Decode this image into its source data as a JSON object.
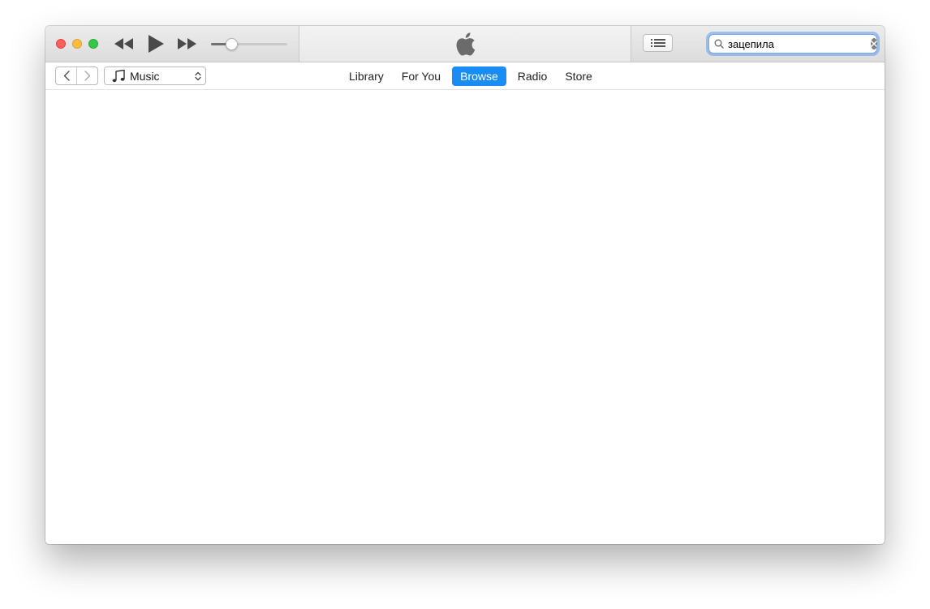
{
  "window": {
    "traffic_lights": [
      "close",
      "minimize",
      "zoom"
    ],
    "colors": {
      "close": "#fc605c",
      "minimize": "#fdbc40",
      "zoom": "#34c84a"
    }
  },
  "transport": {
    "rewind_icon": "rewind-icon",
    "play_icon": "play-icon",
    "fast_forward_icon": "fast-forward-icon"
  },
  "volume": {
    "level": 0.28
  },
  "lcd": {
    "logo": "apple-logo-icon"
  },
  "toolbar": {
    "list_icon": "list-icon"
  },
  "search": {
    "value": "зацепила",
    "icon": "search-icon",
    "clear_icon": "clear-icon",
    "focus_color": "#5e9bf0"
  },
  "navigation": {
    "back_icon": "chevron-left-icon",
    "forward_icon": "chevron-right-icon"
  },
  "media_picker": {
    "icon": "music-note-icon",
    "selected": "Music"
  },
  "tabs": [
    {
      "label": "Library",
      "active": false
    },
    {
      "label": "For You",
      "active": false
    },
    {
      "label": "Browse",
      "active": true
    },
    {
      "label": "Radio",
      "active": false
    },
    {
      "label": "Store",
      "active": false
    }
  ],
  "accent_color": "#1a8cf5"
}
